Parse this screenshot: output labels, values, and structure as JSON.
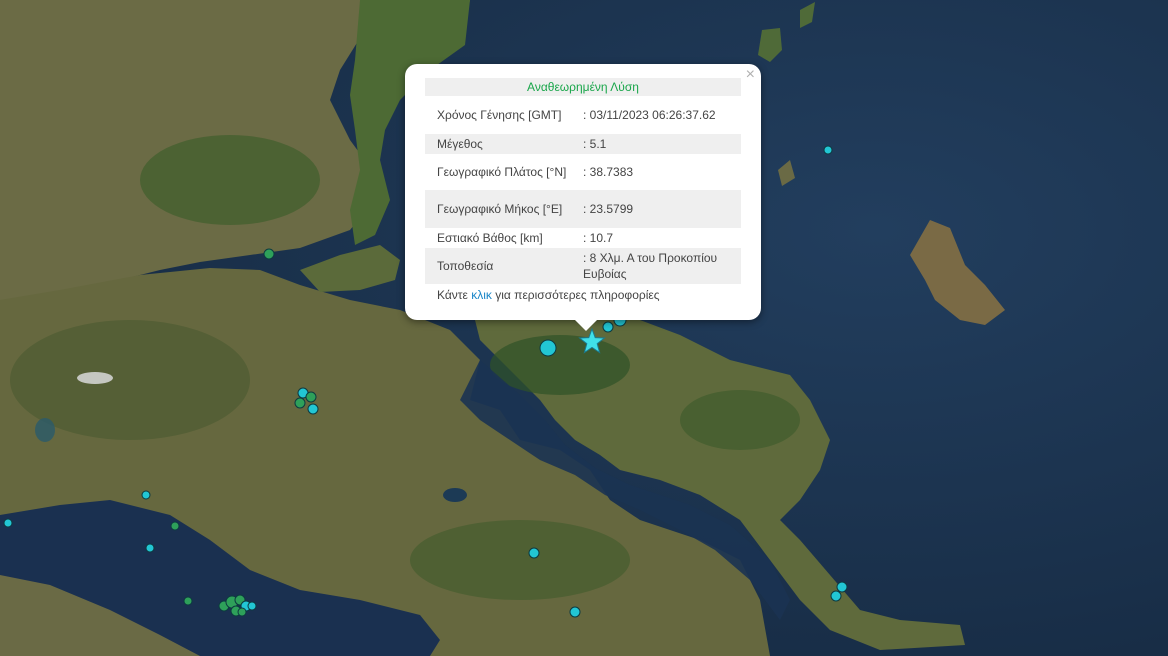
{
  "popup": {
    "close_glyph": "×",
    "header": "Αναθεωρημένη Λύση",
    "rows": [
      {
        "key": "Χρόνος Γένησης [GMT]",
        "value": ": 03/11/2023 06:26:37.62"
      },
      {
        "key": "Μέγεθος",
        "value": ": 5.1"
      },
      {
        "key": "Γεωγραφικό Πλάτος [°N]",
        "value": ": 38.7383"
      },
      {
        "key": "Γεωγραφικό Μήκος [°E]",
        "value": ": 23.5799"
      },
      {
        "key": "Εστιακό Βάθος [km]",
        "value": ": 10.7"
      },
      {
        "key": "Τοποθεσία",
        "value": ": 8 Χλμ. Α του Προκοπίου Ευβοίας"
      }
    ],
    "footer_pre": "Κάντε ",
    "footer_link": "κλικ",
    "footer_post": " για περισσότερες πληροφορίες"
  },
  "map": {
    "colors": {
      "sea": "#1d3552",
      "land": "#5d6a3a",
      "forest": "#3a5a2a",
      "quake_cyan": "#22c6d4",
      "quake_green": "#2ea05a",
      "star": "#40e0e8"
    },
    "epicenter_icon": "star-icon"
  }
}
